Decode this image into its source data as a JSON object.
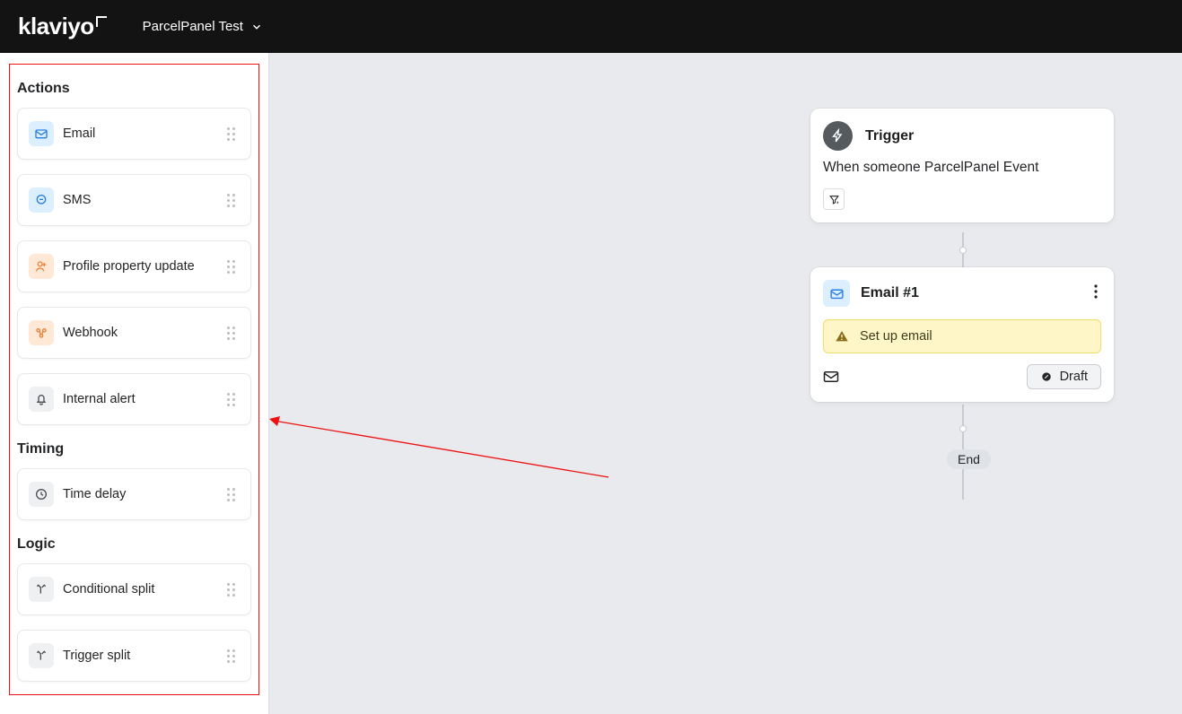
{
  "header": {
    "logo_text": "klaviyo",
    "account_name": "ParcelPanel Test"
  },
  "sidebar": {
    "sections": {
      "actions_label": "Actions",
      "timing_label": "Timing",
      "logic_label": "Logic"
    },
    "actions": [
      {
        "label": "Email"
      },
      {
        "label": "SMS"
      },
      {
        "label": "Profile property update"
      },
      {
        "label": "Webhook"
      },
      {
        "label": "Internal alert"
      }
    ],
    "timing": [
      {
        "label": "Time delay"
      }
    ],
    "logic": [
      {
        "label": "Conditional split"
      },
      {
        "label": "Trigger split"
      }
    ]
  },
  "canvas": {
    "trigger": {
      "title": "Trigger",
      "description": "When someone ParcelPanel Event"
    },
    "email_node": {
      "title": "Email #1",
      "warning_text": "Set up email",
      "status_label": "Draft"
    },
    "end_label": "End"
  }
}
